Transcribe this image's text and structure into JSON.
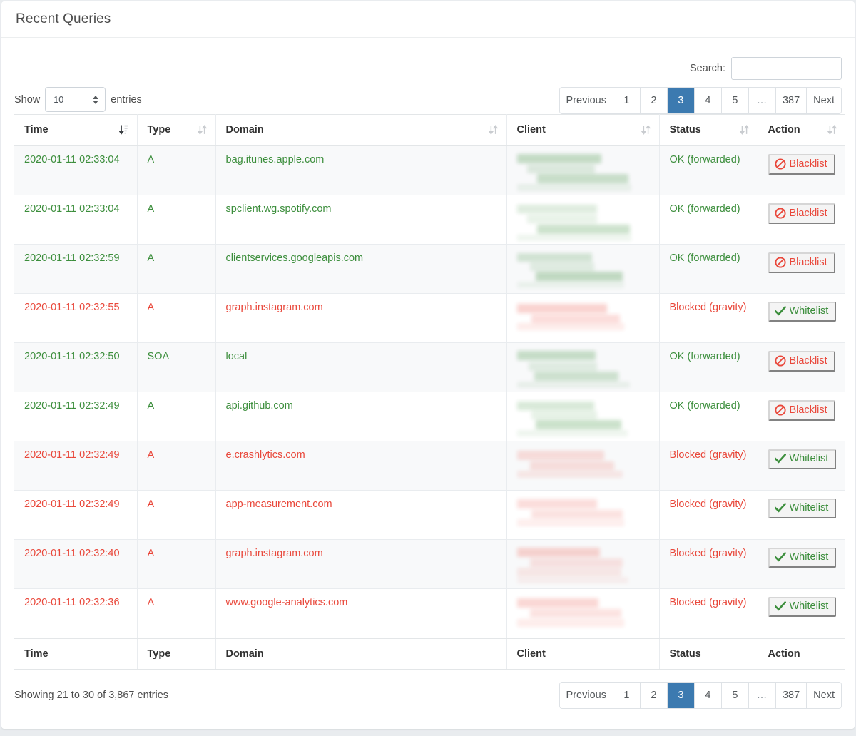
{
  "card": {
    "title": "Recent Queries"
  },
  "controls": {
    "search_label": "Search:",
    "search_value": "",
    "search_placeholder": "",
    "show_label": "Show",
    "entries_label": "entries",
    "page_length": "10"
  },
  "pagination": {
    "previous": "Previous",
    "next": "Next",
    "pages": [
      "1",
      "2",
      "3",
      "4",
      "5"
    ],
    "ellipsis": "…",
    "last_page": "387",
    "active_page": "3"
  },
  "table": {
    "columns": [
      {
        "label": "Time",
        "sort": "desc"
      },
      {
        "label": "Type",
        "sort": "none"
      },
      {
        "label": "Domain",
        "sort": "none"
      },
      {
        "label": "Client",
        "sort": "none"
      },
      {
        "label": "Status",
        "sort": "none"
      },
      {
        "label": "Action",
        "sort": "none"
      }
    ],
    "rows": [
      {
        "time": "2020-01-11 02:33:04",
        "type": "A",
        "domain": "bag.itunes.apple.com",
        "client": "",
        "status": "OK (forwarded)",
        "action": "Blacklist",
        "state": "ok"
      },
      {
        "time": "2020-01-11 02:33:04",
        "type": "A",
        "domain": "spclient.wg.spotify.com",
        "client": "",
        "status": "OK (forwarded)",
        "action": "Blacklist",
        "state": "ok"
      },
      {
        "time": "2020-01-11 02:32:59",
        "type": "A",
        "domain": "clientservices.googleapis.com",
        "client": "",
        "status": "OK (forwarded)",
        "action": "Blacklist",
        "state": "ok"
      },
      {
        "time": "2020-01-11 02:32:55",
        "type": "A",
        "domain": "graph.instagram.com",
        "client": "",
        "status": "Blocked (gravity)",
        "action": "Whitelist",
        "state": "blocked"
      },
      {
        "time": "2020-01-11 02:32:50",
        "type": "SOA",
        "domain": "local",
        "client": "",
        "status": "OK (forwarded)",
        "action": "Blacklist",
        "state": "ok"
      },
      {
        "time": "2020-01-11 02:32:49",
        "type": "A",
        "domain": "api.github.com",
        "client": "",
        "status": "OK (forwarded)",
        "action": "Blacklist",
        "state": "ok"
      },
      {
        "time": "2020-01-11 02:32:49",
        "type": "A",
        "domain": "e.crashlytics.com",
        "client": "",
        "status": "Blocked (gravity)",
        "action": "Whitelist",
        "state": "blocked"
      },
      {
        "time": "2020-01-11 02:32:49",
        "type": "A",
        "domain": "app-measurement.com",
        "client": "",
        "status": "Blocked (gravity)",
        "action": "Whitelist",
        "state": "blocked"
      },
      {
        "time": "2020-01-11 02:32:40",
        "type": "A",
        "domain": "graph.instagram.com",
        "client": "",
        "status": "Blocked (gravity)",
        "action": "Whitelist",
        "state": "blocked"
      },
      {
        "time": "2020-01-11 02:32:36",
        "type": "A",
        "domain": "www.google-analytics.com",
        "client": "",
        "status": "Blocked (gravity)",
        "action": "Whitelist",
        "state": "blocked"
      }
    ],
    "footer_columns": [
      "Time",
      "Type",
      "Domain",
      "Client",
      "Status",
      "Action"
    ]
  },
  "footer": {
    "info": "Showing 21 to 30 of 3,867 entries"
  },
  "colors": {
    "ok": "#3c8e3c",
    "blocked": "#e9483b",
    "active_page": "#3c7ab0",
    "page_bg": "#e9ecef",
    "row_alt": "#f8f9fa"
  }
}
